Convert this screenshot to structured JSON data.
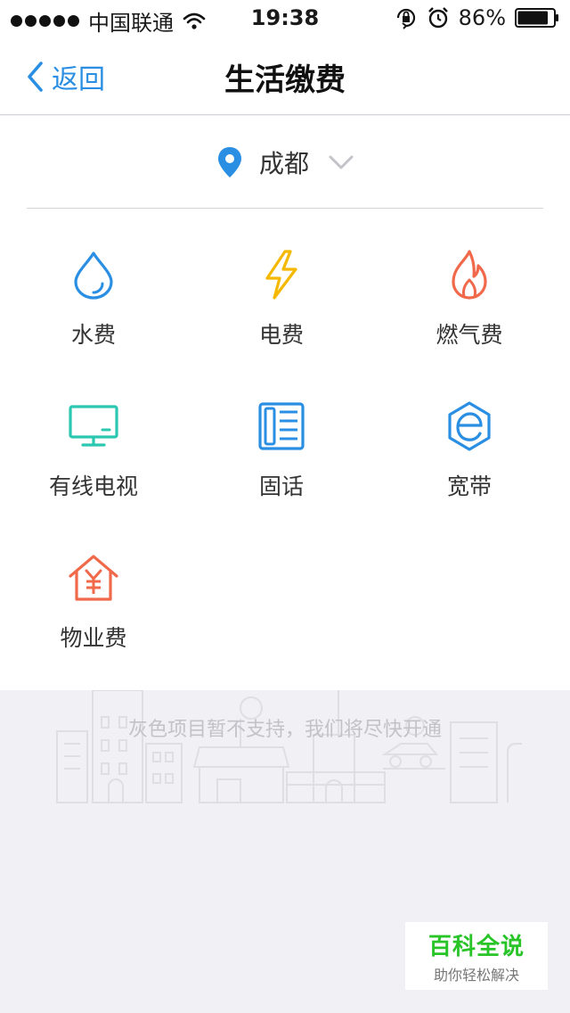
{
  "status_bar": {
    "carrier": "中国联通",
    "time": "19:38",
    "battery": "86%",
    "battery_level": 0.86,
    "icons": [
      "signal-dots-icon",
      "wifi-icon",
      "orientation-lock-icon",
      "alarm-icon",
      "battery-icon"
    ]
  },
  "nav": {
    "back_label": "返回",
    "title": "生活缴费"
  },
  "city": {
    "name": "成都",
    "icon": "location-pin-icon"
  },
  "services": [
    {
      "label": "水费",
      "icon": "water-drop-icon",
      "color": "#2a8fe3"
    },
    {
      "label": "电费",
      "icon": "lightning-icon",
      "color": "#f5b800"
    },
    {
      "label": "燃气费",
      "icon": "flame-icon",
      "color": "#f0694a"
    },
    {
      "label": "有线电视",
      "icon": "tv-icon",
      "color": "#2cc7b0"
    },
    {
      "label": "固话",
      "icon": "phone-icon",
      "color": "#2a8fe3"
    },
    {
      "label": "宽带",
      "icon": "broadband-icon",
      "color": "#2a8fe3"
    },
    {
      "label": "物业费",
      "icon": "house-yen-icon",
      "color": "#f0694a"
    }
  ],
  "notice": "灰色项目暂不支持，我们将尽快开通",
  "watermark": {
    "title": "百科全说",
    "subtitle": "助你轻松解决"
  },
  "colors": {
    "accent": "#2a8fe3",
    "background": "#f0f0f5"
  }
}
